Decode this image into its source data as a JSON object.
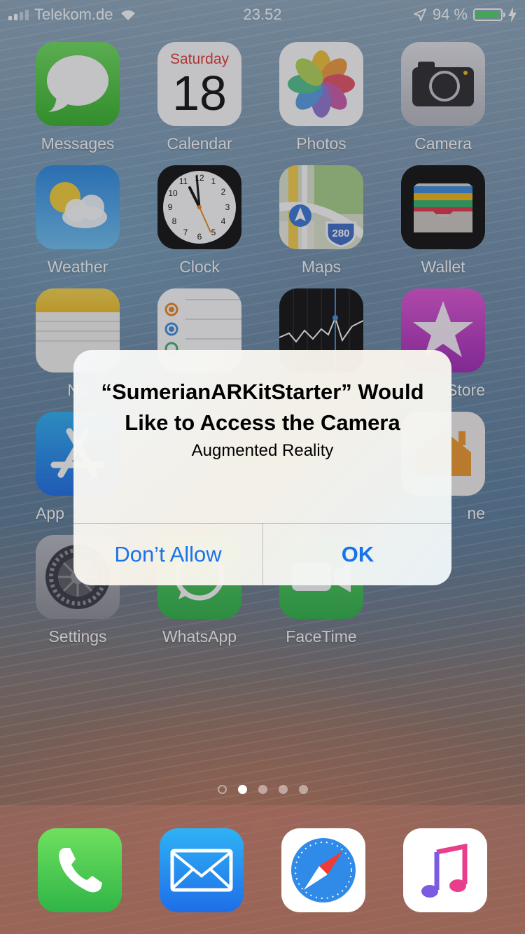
{
  "status_bar": {
    "carrier": "Telekom.de",
    "time": "23.52",
    "battery": "94 %",
    "battery_level": 0.94
  },
  "apps": [
    {
      "label": "Messages",
      "icon": "messages-icon"
    },
    {
      "label": "Calendar",
      "icon": "calendar-icon",
      "weekday": "Saturday",
      "day": "18"
    },
    {
      "label": "Photos",
      "icon": "photos-icon"
    },
    {
      "label": "Camera",
      "icon": "camera-icon"
    },
    {
      "label": "Weather",
      "icon": "weather-icon"
    },
    {
      "label": "Clock",
      "icon": "clock-icon"
    },
    {
      "label": "Maps",
      "icon": "maps-icon",
      "route": "280"
    },
    {
      "label": "Wallet",
      "icon": "wallet-icon"
    },
    {
      "label": "No",
      "icon": "notes-icon"
    },
    {
      "label": "",
      "icon": "reminders-icon"
    },
    {
      "label": "",
      "icon": "stocks-icon"
    },
    {
      "label": "Store",
      "icon": "itunes-store-icon"
    },
    {
      "label": "App",
      "icon": "app-store-icon"
    },
    {
      "label": "ne",
      "icon": "home-icon"
    },
    {
      "label": "Settings",
      "icon": "settings-icon"
    },
    {
      "label": "WhatsApp",
      "icon": "whatsapp-icon"
    },
    {
      "label": "FaceTime",
      "icon": "facetime-icon"
    }
  ],
  "dock": [
    {
      "name": "phone",
      "icon": "phone-icon"
    },
    {
      "name": "mail",
      "icon": "mail-icon"
    },
    {
      "name": "safari",
      "icon": "safari-icon"
    },
    {
      "name": "music",
      "icon": "music-icon"
    }
  ],
  "alert": {
    "title": "“SumerianARKitStarter” Would Like to Access the Camera",
    "message": "Augmented Reality",
    "deny_label": "Don’t Allow",
    "ok_label": "OK"
  },
  "colors": {
    "button_text": "#1a73e8",
    "battery_fill": "#4cd964"
  }
}
